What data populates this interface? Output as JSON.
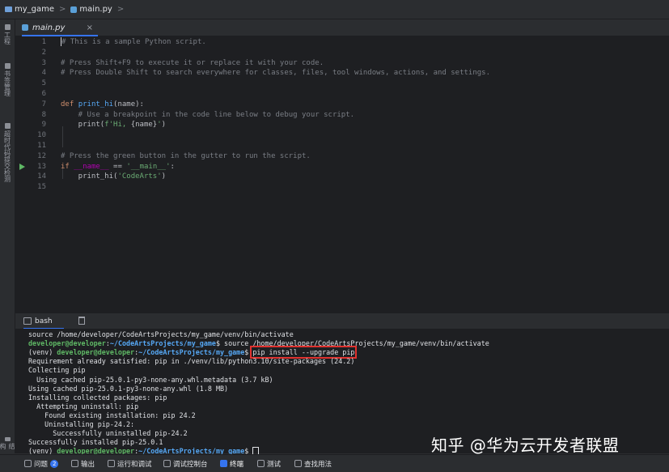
{
  "breadcrumb": {
    "project": "my_game",
    "file": "main.py",
    "separator": ">"
  },
  "left_toolbar": {
    "items": [
      {
        "label": "工程",
        "icon": "project-icon"
      },
      {
        "label": "书签管理",
        "icon": "bookmark-icon"
      },
      {
        "label": "超时代码提交检测",
        "icon": "commit-icon"
      },
      {
        "label": "结构",
        "icon": "structure-icon"
      }
    ]
  },
  "editor": {
    "tab": {
      "label": "main.py",
      "close": "×"
    },
    "lines": [
      {
        "n": "1",
        "tokens": [
          {
            "t": "# This is a sample Python script.",
            "c": "cm"
          }
        ]
      },
      {
        "n": "2",
        "tokens": []
      },
      {
        "n": "3",
        "tokens": [
          {
            "t": "# Press Shift+F9 to execute it or replace it with your code.",
            "c": "cm"
          }
        ]
      },
      {
        "n": "4",
        "tokens": [
          {
            "t": "# Press Double Shift to search everywhere for classes, files, tool windows, actions, and settings.",
            "c": "cm"
          }
        ]
      },
      {
        "n": "5",
        "tokens": []
      },
      {
        "n": "6",
        "tokens": []
      },
      {
        "n": "7",
        "tokens": [
          {
            "t": "def ",
            "c": "kw"
          },
          {
            "t": "print_hi",
            "c": "fn"
          },
          {
            "t": "(name):",
            "c": "par"
          }
        ]
      },
      {
        "n": "8",
        "tokens": [
          {
            "t": "    # Use a breakpoint in the code line below to debug your script.",
            "c": "cm"
          }
        ]
      },
      {
        "n": "9",
        "tokens": [
          {
            "t": "    print(",
            "c": "par"
          },
          {
            "t": "f'Hi, ",
            "c": "str"
          },
          {
            "t": "{name}",
            "c": "par"
          },
          {
            "t": "'",
            "c": "str"
          },
          {
            "t": ")",
            "c": "par"
          }
        ]
      },
      {
        "n": "10",
        "tokens": []
      },
      {
        "n": "11",
        "tokens": []
      },
      {
        "n": "12",
        "tokens": [
          {
            "t": "# Press the green button in the gutter to run the script.",
            "c": "cm"
          }
        ]
      },
      {
        "n": "13",
        "tokens": [
          {
            "t": "if ",
            "c": "kw"
          },
          {
            "t": "__name__",
            "c": "ds"
          },
          {
            "t": " == ",
            "c": "par"
          },
          {
            "t": "'__main__'",
            "c": "str"
          },
          {
            "t": ":",
            "c": "par"
          }
        ]
      },
      {
        "n": "14",
        "tokens": [
          {
            "t": "    print_hi(",
            "c": "par"
          },
          {
            "t": "'CodeArts'",
            "c": "str"
          },
          {
            "t": ")",
            "c": "par"
          }
        ]
      },
      {
        "n": "15",
        "tokens": []
      }
    ]
  },
  "terminal": {
    "tab_label": "bash",
    "lines": [
      [
        {
          "t": "source /home/developer/CodeArtsProjects/my_game/venv/bin/activate",
          "c": ""
        }
      ],
      [
        {
          "t": "developer@developer",
          "c": "pg"
        },
        {
          "t": ":",
          "c": ""
        },
        {
          "t": "~/CodeArtsProjects/my_game",
          "c": "pb"
        },
        {
          "t": "$ source /home/developer/CodeArtsProjects/my_game/venv/bin/activate",
          "c": ""
        }
      ],
      [
        {
          "t": "(venv) ",
          "c": ""
        },
        {
          "t": "developer@developer",
          "c": "pg"
        },
        {
          "t": ":",
          "c": ""
        },
        {
          "t": "~/CodeArtsProjects/my_game",
          "c": "pb"
        },
        {
          "t": "$ ",
          "c": ""
        },
        {
          "t": "pip install --upgrade pip",
          "c": "hl"
        }
      ],
      [
        {
          "t": "Requirement already satisfied: pip in ./venv/lib/python3.10/site-packages (24.2)",
          "c": ""
        }
      ],
      [
        {
          "t": "Collecting pip",
          "c": ""
        }
      ],
      [
        {
          "t": "  Using cached pip-25.0.1-py3-none-any.whl.metadata (3.7 kB)",
          "c": ""
        }
      ],
      [
        {
          "t": "Using cached pip-25.0.1-py3-none-any.whl (1.8 MB)",
          "c": ""
        }
      ],
      [
        {
          "t": "Installing collected packages: pip",
          "c": ""
        }
      ],
      [
        {
          "t": "  Attempting uninstall: pip",
          "c": ""
        }
      ],
      [
        {
          "t": "    Found existing installation: pip 24.2",
          "c": ""
        }
      ],
      [
        {
          "t": "    Uninstalling pip-24.2:",
          "c": ""
        }
      ],
      [
        {
          "t": "      Successfully uninstalled pip-24.2",
          "c": ""
        }
      ],
      [
        {
          "t": "Successfully installed pip-25.0.1",
          "c": ""
        }
      ],
      [
        {
          "t": "(venv) ",
          "c": ""
        },
        {
          "t": "developer@developer",
          "c": "pg"
        },
        {
          "t": ":",
          "c": ""
        },
        {
          "t": "~/CodeArtsProjects/my_game",
          "c": "pb"
        },
        {
          "t": "$ ",
          "c": ""
        }
      ]
    ]
  },
  "watermark": "知乎 @华为云开发者联盟",
  "bottom_bar": {
    "items": [
      {
        "label": "问题",
        "badge": "2",
        "icon": "problems-icon",
        "active": false
      },
      {
        "label": "输出",
        "icon": "output-icon",
        "active": false
      },
      {
        "label": "运行和调试",
        "icon": "run-debug-icon",
        "active": false
      },
      {
        "label": "调试控制台",
        "icon": "debug-console-icon",
        "active": false
      },
      {
        "label": "终端",
        "icon": "terminal-icon",
        "active": true
      },
      {
        "label": "测试",
        "icon": "test-icon",
        "active": false
      },
      {
        "label": "查找用法",
        "icon": "find-usages-icon",
        "active": false
      }
    ]
  },
  "colors": {
    "accent": "#3574f0",
    "highlight_box": "#e0322f",
    "prompt_user": "#5fb865",
    "prompt_path": "#56a8f5"
  }
}
